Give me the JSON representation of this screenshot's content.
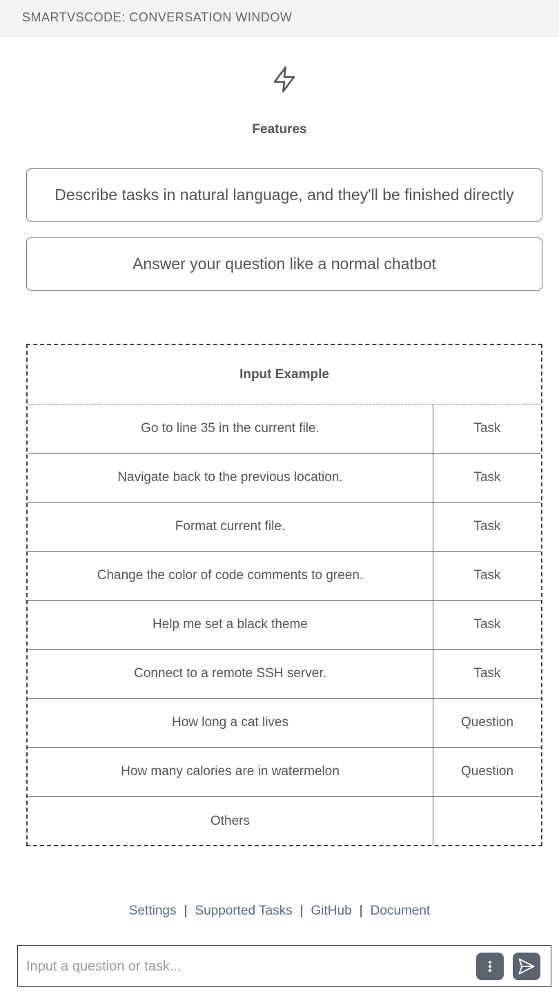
{
  "window": {
    "title": "SMARTVSCODE: CONVERSATION WINDOW"
  },
  "features": {
    "icon": "lightning-icon",
    "title": "Features",
    "items": [
      "Describe tasks in natural language, and they'll be finished directly",
      "Answer your question like a normal chatbot"
    ]
  },
  "examples": {
    "title": "Input Example",
    "rows": [
      {
        "text": "Go to line 35 in the current file.",
        "type": "Task"
      },
      {
        "text": "Navigate back to the previous location.",
        "type": "Task"
      },
      {
        "text": "Format current file.",
        "type": "Task"
      },
      {
        "text": "Change the color of code comments to green.",
        "type": "Task"
      },
      {
        "text": "Help me set a black theme",
        "type": "Task"
      },
      {
        "text": "Connect to a remote SSH server.",
        "type": "Task"
      },
      {
        "text": "How long a cat lives",
        "type": "Question"
      },
      {
        "text": "How many calories are in watermelon",
        "type": "Question"
      },
      {
        "text": "Others",
        "type": ""
      }
    ]
  },
  "footer": {
    "links": [
      "Settings",
      "Supported Tasks",
      "GitHub",
      "Document"
    ],
    "separator": "|"
  },
  "input": {
    "placeholder": "Input a question or task...",
    "value": "",
    "more_icon": "more-vertical-icon",
    "send_icon": "send-icon"
  },
  "colors": {
    "titlebar_bg": "#f3f3f3",
    "link": "#5b6b80",
    "button_bg": "#5b6470"
  }
}
